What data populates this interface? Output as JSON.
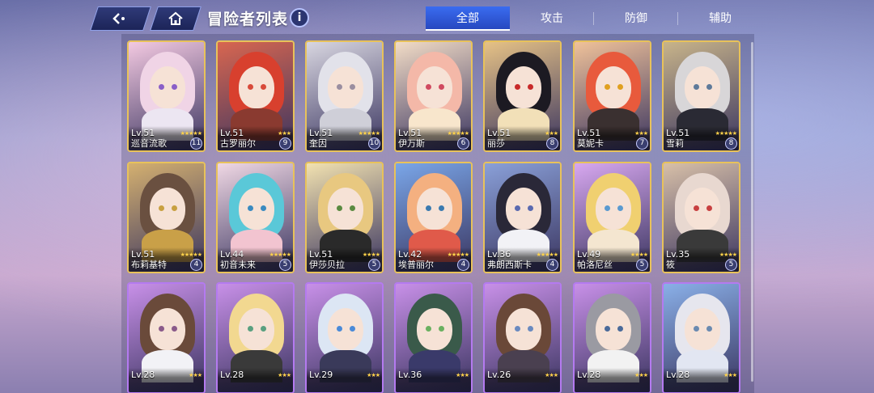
{
  "header": {
    "title": "冒险者列表",
    "info_icon": "i",
    "back_icon": "back-arrow-icon",
    "home_icon": "home-icon"
  },
  "tabs": [
    {
      "label": "全部",
      "active": true
    },
    {
      "label": "攻击",
      "active": false
    },
    {
      "label": "防御",
      "active": false
    },
    {
      "label": "辅助",
      "active": false
    }
  ],
  "characters": [
    {
      "level": "Lv.51",
      "stars": "★★★★★",
      "name": "巡音流歌",
      "count": "11",
      "hair": "#f0d4e6",
      "eyes": "#8a5fc8",
      "outfit": "#ece6f2",
      "bg": "#f3c9e1"
    },
    {
      "level": "Lv.51",
      "stars": "★★★",
      "name": "古罗丽尔",
      "count": "9",
      "hair": "#d8402e",
      "eyes": "#d84a3a",
      "outfit": "#8a3a30",
      "bg": "#d86650"
    },
    {
      "level": "Lv.51",
      "stars": "★★★★★",
      "name": "奎因",
      "count": "10",
      "hair": "#e2e2ea",
      "eyes": "#9a8ea0",
      "outfit": "#cfcfd8",
      "bg": "#d8d6e0"
    },
    {
      "level": "Lv.51",
      "stars": "★★★★★",
      "name": "伊万斯",
      "count": "6",
      "hair": "#f4b8a8",
      "eyes": "#d04a60",
      "outfit": "#f8e6cc",
      "bg": "#f2dcc6"
    },
    {
      "level": "Lv.51",
      "stars": "★★★",
      "name": "丽莎",
      "count": "8",
      "hair": "#1c1a22",
      "eyes": "#c82a2a",
      "outfit": "#f2e0b8",
      "bg": "#e6c286"
    },
    {
      "level": "Lv.51",
      "stars": "★★★",
      "name": "莫妮卡",
      "count": "7",
      "hair": "#e85a3c",
      "eyes": "#e0a020",
      "outfit": "#3a3030",
      "bg": "#f0c29a"
    },
    {
      "level": "Lv.51",
      "stars": "★★★★★",
      "name": "雪莉",
      "count": "8",
      "hair": "#d8d6d8",
      "eyes": "#5e7a9a",
      "outfit": "#2a2a34",
      "bg": "#c8b48a"
    },
    {
      "level": "Lv.51",
      "stars": "★★★★★",
      "name": "布莉基特",
      "count": "4",
      "hair": "#6a5040",
      "eyes": "#c8a040",
      "outfit": "#c9a048",
      "bg": "#d4b070"
    },
    {
      "level": "Lv.44",
      "stars": "★★★★★",
      "name": "初音未来",
      "count": "5",
      "hair": "#5ac8d8",
      "eyes": "#3a8ac0",
      "outfit": "#f2c4d0",
      "bg": "#f0d8e4"
    },
    {
      "level": "Lv.51",
      "stars": "★★★★",
      "name": "伊莎贝拉",
      "count": "5",
      "hair": "#e8c880",
      "eyes": "#5a8a40",
      "outfit": "#2a2a2a",
      "bg": "#f2e2b0"
    },
    {
      "level": "Lv.42",
      "stars": "★★★★★",
      "name": "埃普丽尔",
      "count": "4",
      "hair": "#f4b080",
      "eyes": "#3a7ab0",
      "outfit": "#e05a4a",
      "bg": "#7aa6e8"
    },
    {
      "level": "Lv.36",
      "stars": "★★★★★",
      "name": "弗朗西斯卡",
      "count": "4",
      "hair": "#2a2838",
      "eyes": "#5a6ab0",
      "outfit": "#f2f2f6",
      "bg": "#8aa0d8"
    },
    {
      "level": "Lv.49",
      "stars": "★★★★",
      "name": "帕洛尼丝",
      "count": "5",
      "hair": "#f0d070",
      "eyes": "#5a9ad0",
      "outfit": "#f4e6d0",
      "bg": "#d8a8f0"
    },
    {
      "level": "Lv.35",
      "stars": "★★★★",
      "name": "筱",
      "count": "5",
      "hair": "#e8d8d0",
      "eyes": "#c84040",
      "outfit": "#3a3a3a",
      "bg": "#d8c0a8"
    },
    {
      "level": "Lv.28",
      "stars": "★★★",
      "name": "",
      "count": "",
      "hair": "#6a4a3a",
      "eyes": "#8a5a8a",
      "outfit": "#f2f2f6",
      "bg": "#c890e8"
    },
    {
      "level": "Lv.28",
      "stars": "★★★",
      "name": "",
      "count": "",
      "hair": "#f2d890",
      "eyes": "#5aa080",
      "outfit": "#3a3a3a",
      "bg": "#c890e8"
    },
    {
      "level": "Lv.29",
      "stars": "★★★",
      "name": "",
      "count": "",
      "hair": "#dce6f4",
      "eyes": "#4a8ad8",
      "outfit": "#3a3a5a",
      "bg": "#c890e8"
    },
    {
      "level": "Lv.36",
      "stars": "★★★",
      "name": "",
      "count": "",
      "hair": "#3a5a4a",
      "eyes": "#6ab060",
      "outfit": "#3a3a6a",
      "bg": "#c890e8"
    },
    {
      "level": "Lv.26",
      "stars": "★★★",
      "name": "",
      "count": "",
      "hair": "#6a4838",
      "eyes": "#6a8ac0",
      "outfit": "#4a4050",
      "bg": "#c890e8"
    },
    {
      "level": "Lv.28",
      "stars": "★★★",
      "name": "",
      "count": "",
      "hair": "#9a9aa2",
      "eyes": "#4a6a9a",
      "outfit": "#f2f2f2",
      "bg": "#c890e8"
    },
    {
      "level": "Lv.28",
      "stars": "★★★",
      "name": "",
      "count": "",
      "hair": "#e6e6ee",
      "eyes": "#6a8ab0",
      "outfit": "#e2e6f2",
      "bg": "#8ab0e8"
    }
  ]
}
